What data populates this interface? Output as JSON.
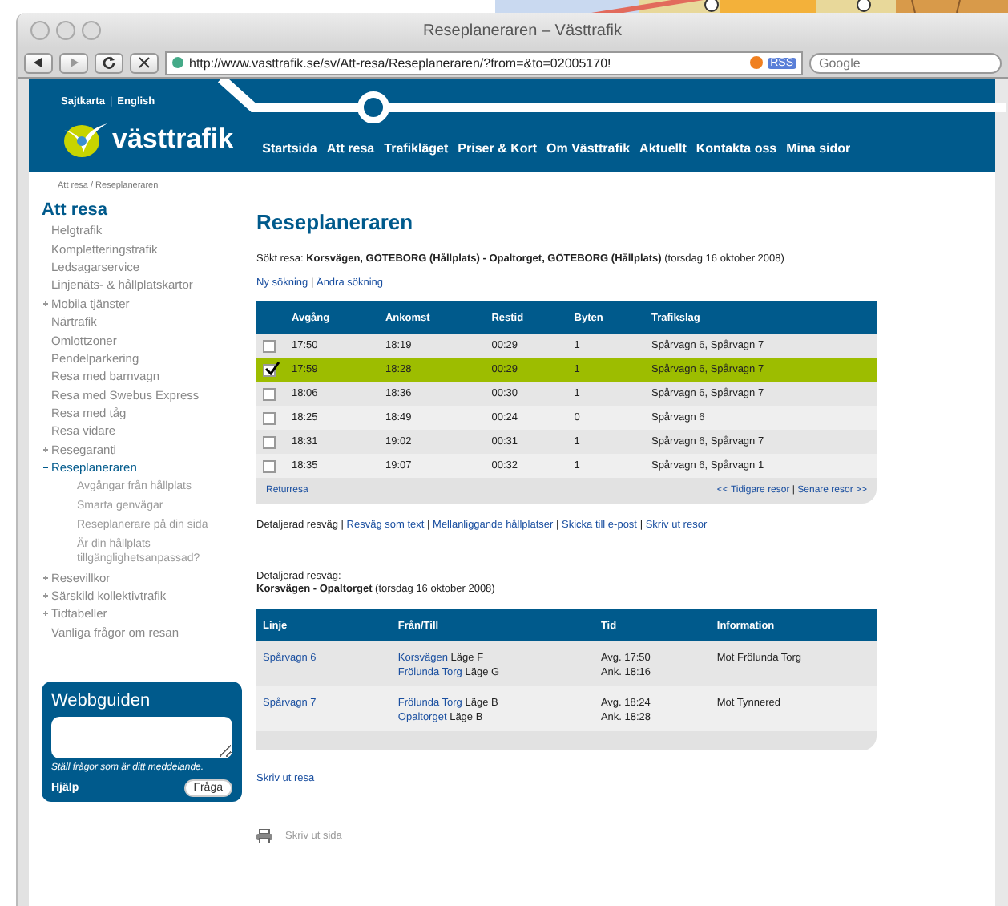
{
  "window": {
    "title": "Reseplaneraren – Västtrafik"
  },
  "toolbar": {
    "url": "http://www.vasttrafik.se/sv/Att-resa/Reseplaneraren/?from=&to=02005170!",
    "rss": "RSS",
    "search_placeholder": "Google"
  },
  "header": {
    "top_links": [
      "Sajtkarta",
      "English"
    ],
    "top_links_separator": "|",
    "logo": "västtrafik",
    "nav": [
      "Startsida",
      "Att resa",
      "Trafikläget",
      "Priser & Kort",
      "Om Västtrafik",
      "Aktuellt",
      "Kontakta oss",
      "Mina sidor"
    ]
  },
  "breadcrumb": "Att resa / Reseplaneraren",
  "sidebar": {
    "heading": "Att resa",
    "items": [
      {
        "label": "Helgtrafik",
        "kind": "plain"
      },
      {
        "label": "Kompletteringstrafik",
        "kind": "plain"
      },
      {
        "label": "Ledsagarservice",
        "kind": "plain"
      },
      {
        "label": "Linjenäts- & hållplatskartor",
        "kind": "plain"
      },
      {
        "label": "Mobila tjänster",
        "kind": "collapsed"
      },
      {
        "label": "Närtrafik",
        "kind": "plain"
      },
      {
        "label": "Omlottzoner",
        "kind": "plain"
      },
      {
        "label": "Pendelparkering",
        "kind": "plain"
      },
      {
        "label": "Resa med barnvagn",
        "kind": "plain"
      },
      {
        "label": "Resa med Swebus Express",
        "kind": "plain"
      },
      {
        "label": "Resa med tåg",
        "kind": "plain"
      },
      {
        "label": "Resa vidare",
        "kind": "plain"
      },
      {
        "label": "Resegaranti",
        "kind": "collapsed"
      },
      {
        "label": "Reseplaneraren",
        "kind": "expanded",
        "children": [
          {
            "label": "Avgångar från hållplats"
          },
          {
            "label": "Smarta genvägar"
          },
          {
            "label": "Reseplanerare på din sida"
          },
          {
            "label": "Är din hållplats tillgänglighetsanpassad?"
          }
        ]
      },
      {
        "label": "Resevillkor",
        "kind": "collapsed"
      },
      {
        "label": "Särskild kollektivtrafik",
        "kind": "collapsed"
      },
      {
        "label": "Tidtabeller",
        "kind": "collapsed"
      },
      {
        "label": "Vanliga frågor om resan",
        "kind": "plain"
      }
    ]
  },
  "webbguiden": {
    "title": "Webbguiden",
    "hint": "Ställ frågor som är ditt meddelande.",
    "help": "Hjälp",
    "button": "Fråga"
  },
  "content": {
    "title": "Reseplaneraren",
    "summary": "Sökt resa: **Korsvägen, GÖTEBORG (Hållplats) - Opaltorget, GÖTEBORG (Hållplats)** (torsdag 16 oktober 2008)",
    "search_links": [
      "Ny sökning",
      "Ändra sökning"
    ],
    "search_links_separator": "|",
    "trips": {
      "columns": [
        "Avgång",
        "Ankomst",
        "Restid",
        "Byten",
        "Trafikslag"
      ],
      "rows": [
        {
          "cells": [
            "17:50",
            "18:19",
            "00:29",
            "1",
            "Spårvagn 6, Spårvagn 7"
          ],
          "selected": false
        },
        {
          "cells": [
            "17:59",
            "18:28",
            "00:29",
            "1",
            "Spårvagn 6, Spårvagn 7"
          ],
          "selected": true
        },
        {
          "cells": [
            "18:06",
            "18:36",
            "00:30",
            "1",
            "Spårvagn 6, Spårvagn 7"
          ],
          "selected": false
        },
        {
          "cells": [
            "18:25",
            "18:49",
            "00:24",
            "0",
            "Spårvagn 6"
          ],
          "selected": false
        },
        {
          "cells": [
            "18:31",
            "19:02",
            "00:31",
            "1",
            "Spårvagn 6, Spårvagn 7"
          ],
          "selected": false
        },
        {
          "cells": [
            "18:35",
            "19:07",
            "00:32",
            "1",
            "Spårvagn 6, Spårvagn 1"
          ],
          "selected": false
        }
      ],
      "return_link": "Returresa",
      "earlier": "<< Tidigare resor",
      "pager_separator": "|",
      "later": "Senare resor >>"
    },
    "view_link_separators": [
      "|",
      "|",
      "|",
      "|"
    ],
    "view_links": [
      {
        "label": "Detaljerad resväg",
        "kind": "current"
      },
      {
        "label": "Resväg som text",
        "kind": "link"
      },
      {
        "label": "Mellanliggande hållplatser",
        "kind": "link"
      },
      {
        "label": "Skicka till e-post",
        "kind": "link"
      },
      {
        "label": "Skriv ut resor",
        "kind": "link"
      }
    ],
    "detail_label": "Detaljerad resväg:",
    "detail_route": "**Korsvägen - Opaltorget** (torsdag 16 oktober 2008)",
    "legs": {
      "columns": [
        "Linje",
        "Från/Till",
        "Tid",
        "Information"
      ],
      "rows": [
        {
          "line": "Spårvagn 6",
          "from_stop": "Korsvägen",
          "from_pos": "Läge F",
          "to_stop": "Frölunda Torg",
          "to_pos": "Läge G",
          "dep": "Avg. 17:50",
          "arr": "Ank. 18:16",
          "info": "Mot Frölunda Torg"
        },
        {
          "line": "Spårvagn 7",
          "from_stop": "Frölunda Torg",
          "from_pos": "Läge B",
          "to_stop": "Opaltorget",
          "to_pos": "Läge B",
          "dep": "Avg. 18:24",
          "arr": "Ank. 18:28",
          "info": "Mot Tynnered"
        }
      ]
    },
    "print_trip": "Skriv ut resa",
    "print_page": "Skriv ut sida"
  }
}
